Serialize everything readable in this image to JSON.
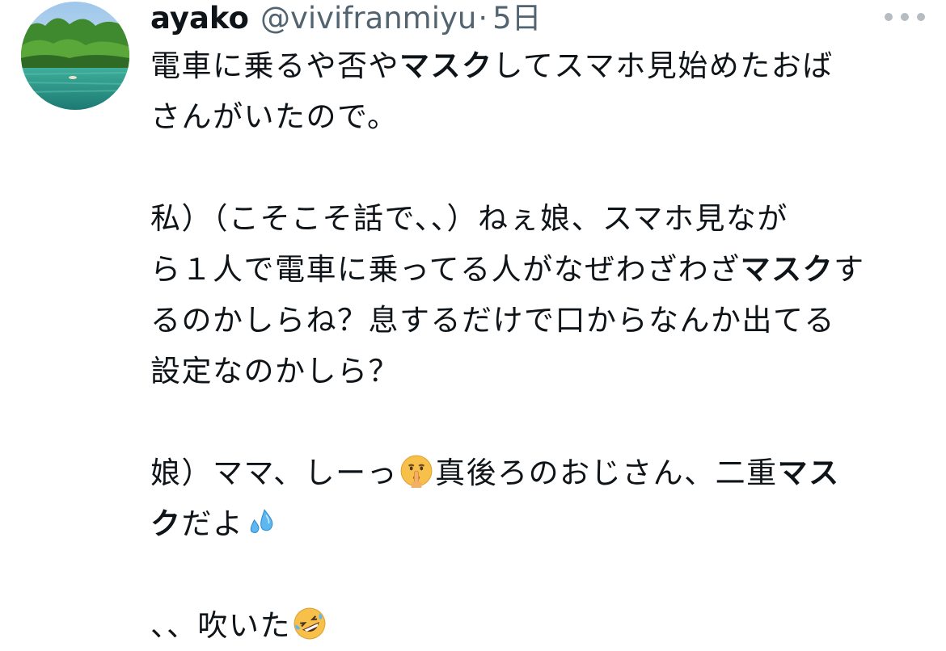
{
  "tweet": {
    "author": {
      "display_name": "ayako",
      "handle": "@vivifranmiyu",
      "separator": "·",
      "timestamp": "5日",
      "avatar_icon": "lake-forest-avatar-icon"
    },
    "more_icon": "more-options-icon",
    "body": {
      "p1_l1_a": "電車に乗るや否や",
      "p1_l1_b": "マスク",
      "p1_l1_c": "してスマホ見始めたおば",
      "p1_l2": "さんがいたので。",
      "p2_l1": "私）（こそこそ話で、、）ねぇ娘、スマホ見なが",
      "p2_l2_a": "ら１人で電車に乗ってる人がなぜわざわざ",
      "p2_l2_b": "マスク",
      "p2_l2_c": "す",
      "p2_l3": "るのかしらね？息するだけで口からなんか出てる",
      "p2_l4": "設定なのかしら？",
      "p3_l1_a": "娘）ママ、しーっ",
      "p3_l1_b": "真後ろのおじさん、二重",
      "p3_l1_c": "マス",
      "p3_l2_a": "ク",
      "p3_l2_b": "だよ",
      "p4_l1": "、、吹いた"
    },
    "emojis": [
      "shushing-face-icon",
      "sweat-droplets-icon",
      "rofl-face-icon"
    ]
  }
}
